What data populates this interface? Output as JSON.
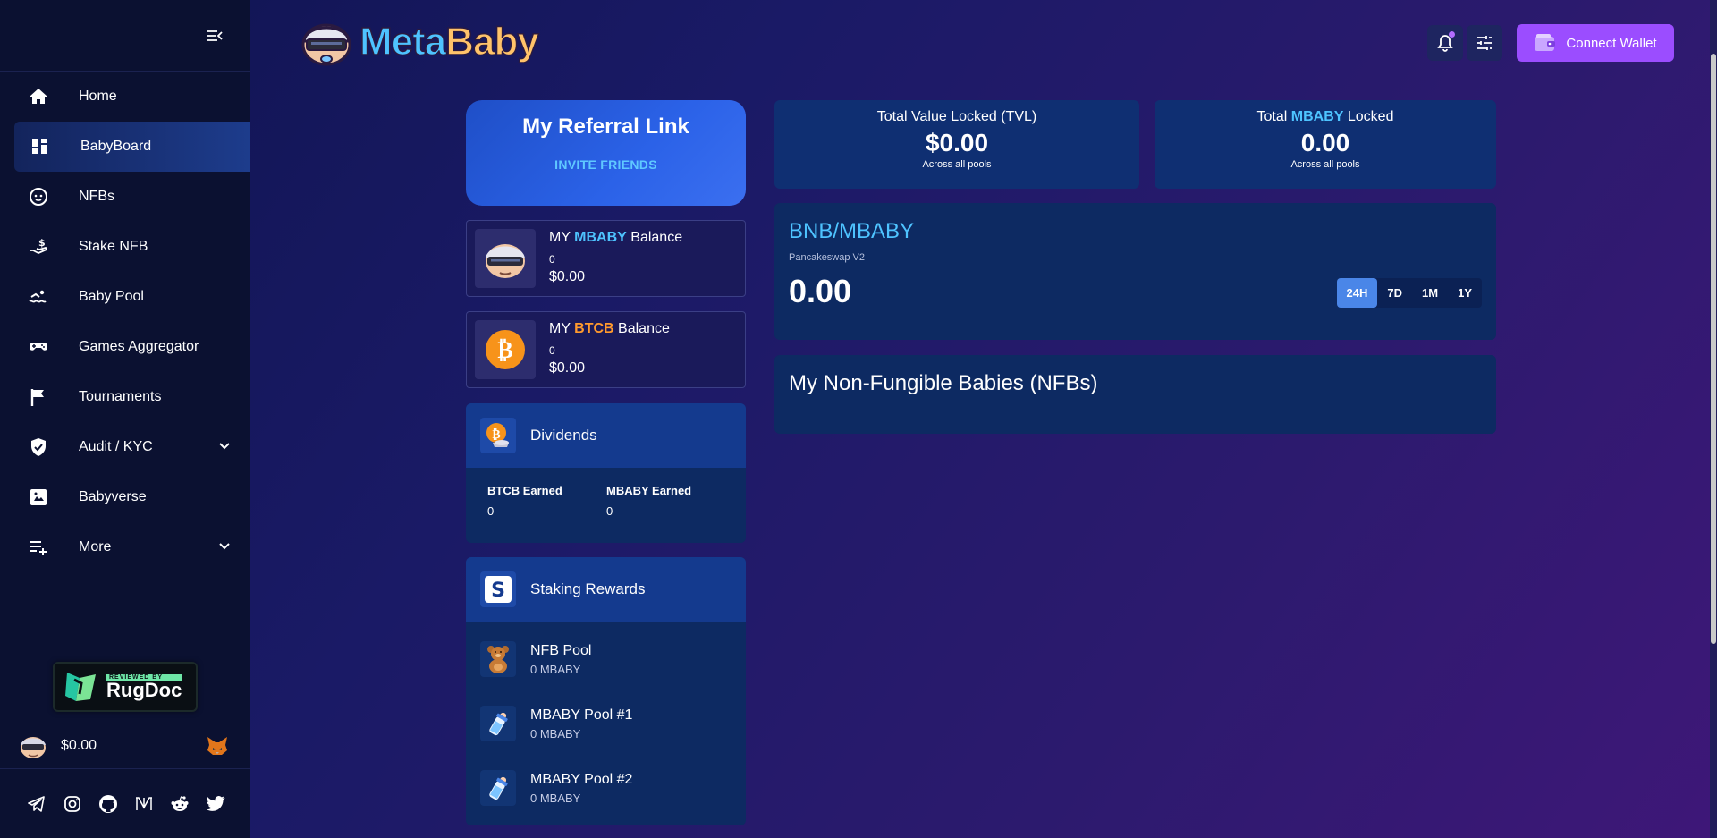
{
  "sidebar": {
    "items": [
      {
        "label": "Home",
        "icon": "home-icon"
      },
      {
        "label": "BabyBoard",
        "icon": "dashboard-icon",
        "active": true
      },
      {
        "label": "NFBs",
        "icon": "baby-face-icon"
      },
      {
        "label": "Stake NFB",
        "icon": "stake-hand-icon"
      },
      {
        "label": "Baby Pool",
        "icon": "swim-icon"
      },
      {
        "label": "Games Aggregator",
        "icon": "gamepad-icon"
      },
      {
        "label": "Tournaments",
        "icon": "flag-icon"
      },
      {
        "label": "Audit / KYC",
        "icon": "shield-check-icon",
        "expandable": true
      },
      {
        "label": "Babyverse",
        "icon": "babyverse-icon"
      },
      {
        "label": "More",
        "icon": "playlist-add-icon",
        "expandable": true
      }
    ],
    "badge": {
      "reviewed": "REVIEWED BY",
      "name": "RugDoc"
    },
    "price": "$0.00",
    "socials": [
      "telegram-icon",
      "instagram-icon",
      "github-icon",
      "medium-icon",
      "reddit-icon",
      "twitter-icon"
    ]
  },
  "header": {
    "logo": {
      "meta": "Meta",
      "baby": "Baby"
    },
    "connect_label": "Connect Wallet",
    "accent": "#9b4dff"
  },
  "referral": {
    "title": "My Referral Link",
    "link": "INVITE FRIENDS"
  },
  "balances": [
    {
      "prefix": "MY ",
      "token": "MBABY",
      "suffix": " Balance",
      "qty": "0",
      "usd": "$0.00"
    },
    {
      "prefix": "MY ",
      "token": "BTCB",
      "suffix": " Balance",
      "qty": "0",
      "usd": "$0.00"
    }
  ],
  "dividends": {
    "title": "Dividends",
    "btcb_label": "BTCB Earned",
    "btcb_value": "0",
    "mbaby_label": "MBABY Earned",
    "mbaby_value": "0"
  },
  "staking": {
    "title": "Staking Rewards",
    "pools": [
      {
        "name": "NFB Pool",
        "amount": "0 MBABY",
        "icon": "teddy-bear-icon"
      },
      {
        "name": "MBABY Pool #1",
        "amount": "0 MBABY",
        "icon": "baby-bottle-icon"
      },
      {
        "name": "MBABY Pool #2",
        "amount": "0 MBABY",
        "icon": "baby-bottle-icon"
      }
    ]
  },
  "stats": {
    "tvl": {
      "title": "Total Value Locked (TVL)",
      "value": "$0.00",
      "sub": "Across all pools"
    },
    "locked": {
      "prefix": "Total ",
      "token": "MBABY",
      "suffix": " Locked",
      "value": "0.00",
      "sub": "Across all pools"
    }
  },
  "pair": {
    "title": "BNB/MBABY",
    "source": "Pancakeswap V2",
    "value": "0.00",
    "ranges": [
      "24H",
      "7D",
      "1M",
      "1Y"
    ],
    "active_range": "24H"
  },
  "nfbs": {
    "title": "My Non-Fungible Babies (NFBs)"
  }
}
